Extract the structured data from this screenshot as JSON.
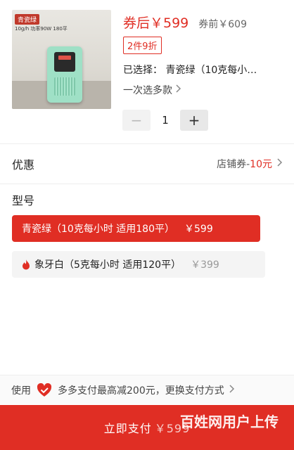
{
  "product": {
    "image_tag": "青瓷绿",
    "image_spec": "10g/h 功率90W 180平",
    "price_after_label": "券后￥599",
    "price_before_label": "券前￥609",
    "discount_badge": "2件9折",
    "selected_label": "已选择：  青瓷绿（10克每小…",
    "multi_select_label": "一次选多款",
    "quantity": "1",
    "minus_label": "−",
    "plus_label": "+"
  },
  "coupon": {
    "label": "优惠",
    "value_prefix": "店铺券-",
    "value_amount": "10元"
  },
  "model": {
    "title": "型号",
    "options": [
      {
        "name": "青瓷绿（10克每小时 适用180平）",
        "price": "￥599",
        "selected": true
      },
      {
        "name": "象牙白（5克每小时 适用120平）",
        "price": "￥399",
        "selected": false
      }
    ]
  },
  "pay": {
    "tip_prefix": "使用",
    "tip_text": "多多支付最高减200元，更换支付方式",
    "button_label": "立即支付",
    "button_price": "￥599",
    "watermark": "百姓网用户上传"
  },
  "colors": {
    "accent": "#e02e24",
    "device": "#9fe0c6"
  },
  "icons": [
    "chevron-right-icon",
    "flame-icon",
    "heart-check-icon"
  ]
}
